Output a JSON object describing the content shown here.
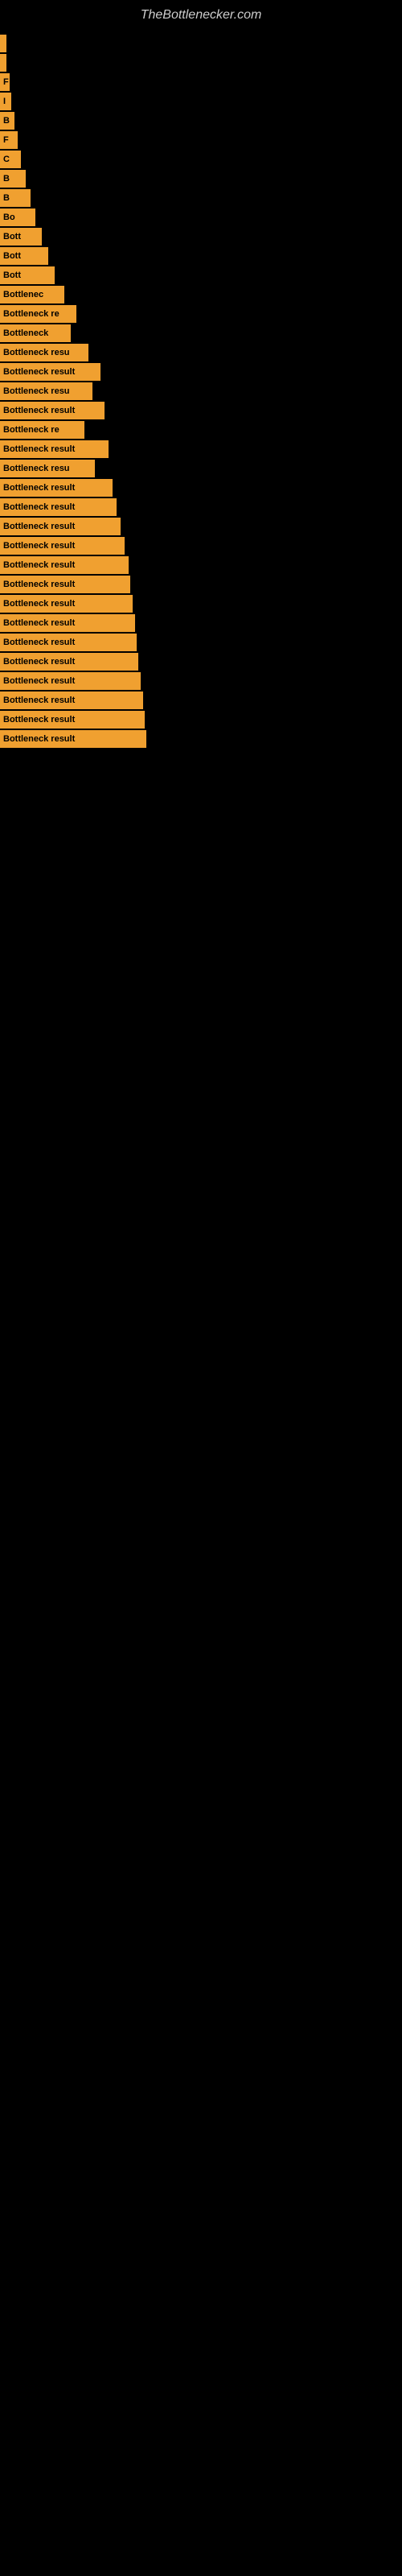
{
  "site": {
    "title": "TheBottlenecker.com"
  },
  "bars": [
    {
      "id": 1,
      "label": "",
      "width": 8
    },
    {
      "id": 2,
      "label": "",
      "width": 8
    },
    {
      "id": 3,
      "label": "F",
      "width": 12
    },
    {
      "id": 4,
      "label": "I",
      "width": 14
    },
    {
      "id": 5,
      "label": "B",
      "width": 18
    },
    {
      "id": 6,
      "label": "F",
      "width": 22
    },
    {
      "id": 7,
      "label": "C",
      "width": 26
    },
    {
      "id": 8,
      "label": "B",
      "width": 32
    },
    {
      "id": 9,
      "label": "B",
      "width": 38
    },
    {
      "id": 10,
      "label": "Bo",
      "width": 44
    },
    {
      "id": 11,
      "label": "Bott",
      "width": 52
    },
    {
      "id": 12,
      "label": "Bott",
      "width": 60
    },
    {
      "id": 13,
      "label": "Bott",
      "width": 68
    },
    {
      "id": 14,
      "label": "Bottlenec",
      "width": 80
    },
    {
      "id": 15,
      "label": "Bottleneck re",
      "width": 95
    },
    {
      "id": 16,
      "label": "Bottleneck",
      "width": 88
    },
    {
      "id": 17,
      "label": "Bottleneck resu",
      "width": 110
    },
    {
      "id": 18,
      "label": "Bottleneck result",
      "width": 125
    },
    {
      "id": 19,
      "label": "Bottleneck resu",
      "width": 115
    },
    {
      "id": 20,
      "label": "Bottleneck result",
      "width": 130
    },
    {
      "id": 21,
      "label": "Bottleneck re",
      "width": 105
    },
    {
      "id": 22,
      "label": "Bottleneck result",
      "width": 135
    },
    {
      "id": 23,
      "label": "Bottleneck resu",
      "width": 118
    },
    {
      "id": 24,
      "label": "Bottleneck result",
      "width": 140
    },
    {
      "id": 25,
      "label": "Bottleneck result",
      "width": 145
    },
    {
      "id": 26,
      "label": "Bottleneck result",
      "width": 150
    },
    {
      "id": 27,
      "label": "Bottleneck result",
      "width": 155
    },
    {
      "id": 28,
      "label": "Bottleneck result",
      "width": 160
    },
    {
      "id": 29,
      "label": "Bottleneck result",
      "width": 162
    },
    {
      "id": 30,
      "label": "Bottleneck result",
      "width": 165
    },
    {
      "id": 31,
      "label": "Bottleneck result",
      "width": 168
    },
    {
      "id": 32,
      "label": "Bottleneck result",
      "width": 170
    },
    {
      "id": 33,
      "label": "Bottleneck result",
      "width": 172
    },
    {
      "id": 34,
      "label": "Bottleneck result",
      "width": 175
    },
    {
      "id": 35,
      "label": "Bottleneck result",
      "width": 178
    },
    {
      "id": 36,
      "label": "Bottleneck result",
      "width": 180
    },
    {
      "id": 37,
      "label": "Bottleneck result",
      "width": 182
    }
  ]
}
